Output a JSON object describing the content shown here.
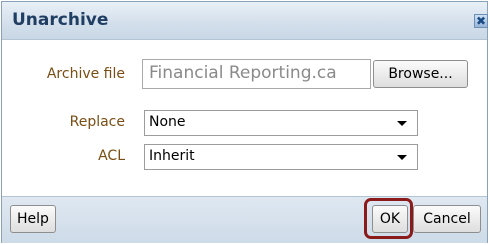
{
  "dialog": {
    "title": "Unarchive",
    "close_glyph": "✖",
    "close_icon": "close-icon"
  },
  "form": {
    "archive_file_label": "Archive file",
    "archive_file_value": "Financial Reporting.ca",
    "browse_label": "Browse...",
    "replace_label": "Replace",
    "replace_value": "None",
    "acl_label": "ACL",
    "acl_value": "Inherit"
  },
  "footer": {
    "help_label": "Help",
    "ok_label": "OK",
    "cancel_label": "Cancel"
  },
  "colors": {
    "title_text": "#1f3e62",
    "label_text": "#7a4e14",
    "highlight_border": "#8b1a1a"
  }
}
